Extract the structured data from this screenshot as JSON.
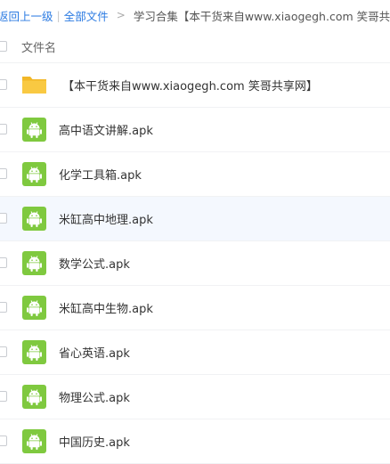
{
  "breadcrumb": {
    "back": "返回上一级",
    "separator": "|",
    "all_files": "全部文件",
    "arrow": ">",
    "current": "学习合集【本干货来自www.xiaogegh.com 笑哥共..."
  },
  "header": {
    "name_label": "文件名"
  },
  "files": [
    {
      "name": "【本干货来自www.xiaogegh.com 笑哥共享网】",
      "type": "folder",
      "icon": "folder-icon"
    },
    {
      "name": "高中语文讲解.apk",
      "type": "apk",
      "icon": "android-icon"
    },
    {
      "name": "化学工具箱.apk",
      "type": "apk",
      "icon": "android-icon"
    },
    {
      "name": "米缸高中地理.apk",
      "type": "apk",
      "icon": "android-icon",
      "hovered": true
    },
    {
      "name": "数学公式.apk",
      "type": "apk",
      "icon": "android-icon"
    },
    {
      "name": "米缸高中生物.apk",
      "type": "apk",
      "icon": "android-icon"
    },
    {
      "name": "省心英语.apk",
      "type": "apk",
      "icon": "android-icon"
    },
    {
      "name": "物理公式.apk",
      "type": "apk",
      "icon": "android-icon"
    },
    {
      "name": "中国历史.apk",
      "type": "apk",
      "icon": "android-icon"
    }
  ],
  "colors": {
    "link": "#2a7ae2",
    "apk_icon": "#7fc93f",
    "folder_icon": "#f9c942",
    "hover_row": "#f4f8fe"
  }
}
